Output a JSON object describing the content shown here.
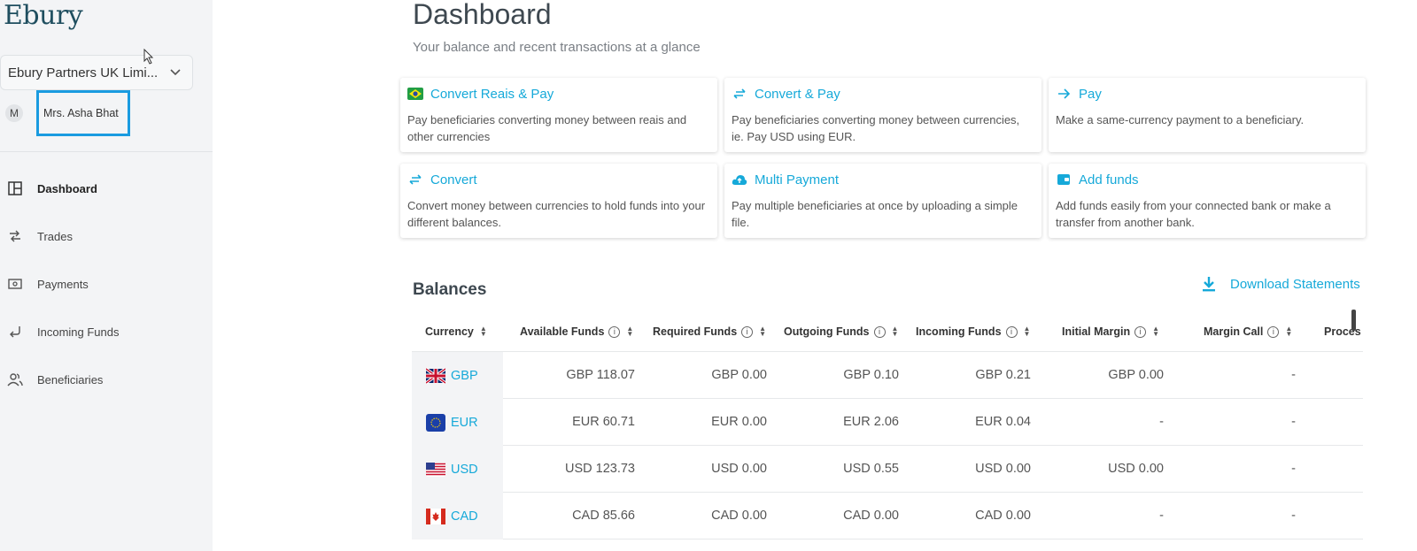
{
  "sidebar": {
    "logo": "Ebury",
    "entity": "Ebury Partners UK Limi...",
    "user_initial": "M",
    "user_name": "Mrs. Asha Bhat",
    "nav": [
      {
        "label": "Dashboard",
        "icon": "dashboard-icon",
        "active": true
      },
      {
        "label": "Trades",
        "icon": "trades-icon"
      },
      {
        "label": "Payments",
        "icon": "payments-icon"
      },
      {
        "label": "Incoming Funds",
        "icon": "incoming-funds-icon"
      },
      {
        "label": "Beneficiaries",
        "icon": "beneficiaries-icon"
      }
    ]
  },
  "header": {
    "title": "Dashboard",
    "subtitle": "Your balance and recent transactions at a glance"
  },
  "cards": [
    {
      "title": "Convert Reais & Pay",
      "desc": "Pay beneficiaries converting money between reais and other currencies",
      "icon": "brazil-flag-icon"
    },
    {
      "title": "Convert & Pay",
      "desc": "Pay beneficiaries converting money between currencies, ie. Pay USD using EUR.",
      "icon": "swap-arrows-icon"
    },
    {
      "title": "Pay",
      "desc": "Make a same-currency payment to a beneficiary.",
      "icon": "arrow-right-icon"
    },
    {
      "title": "Convert",
      "desc": "Convert money between currencies to hold funds into your different balances.",
      "icon": "swap-arrows-icon"
    },
    {
      "title": "Multi Payment",
      "desc": "Pay multiple beneficiaries at once by uploading a simple file.",
      "icon": "cloud-upload-icon"
    },
    {
      "title": "Add funds",
      "desc": "Add funds easily from your connected bank or make a transfer from another bank.",
      "icon": "wallet-icon"
    }
  ],
  "balances": {
    "title": "Balances",
    "download_label": "Download Statements",
    "columns": [
      "Currency",
      "Available Funds",
      "Required Funds",
      "Outgoing Funds",
      "Incoming Funds",
      "Initial Margin",
      "Margin Call",
      "Proces"
    ],
    "rows": [
      {
        "code": "GBP",
        "flag": "uk-flag-icon",
        "cells": [
          "GBP 118.07",
          "GBP 0.00",
          "GBP 0.10",
          "GBP 0.21",
          "GBP 0.00",
          "-"
        ]
      },
      {
        "code": "EUR",
        "flag": "eu-flag-icon",
        "cells": [
          "EUR 60.71",
          "EUR 0.00",
          "EUR 2.06",
          "EUR 0.04",
          "-",
          "-"
        ]
      },
      {
        "code": "USD",
        "flag": "us-flag-icon",
        "cells": [
          "USD 123.73",
          "USD 0.00",
          "USD 0.55",
          "USD 0.00",
          "USD 0.00",
          "-"
        ]
      },
      {
        "code": "CAD",
        "flag": "canada-flag-icon",
        "cells": [
          "CAD 85.66",
          "CAD 0.00",
          "CAD 0.00",
          "CAD 0.00",
          "-",
          "-"
        ]
      }
    ]
  },
  "colors": {
    "accent": "#16a9d9",
    "highlight_box": "#1a9be0",
    "sidebar_bg": "#f3f4f6"
  }
}
